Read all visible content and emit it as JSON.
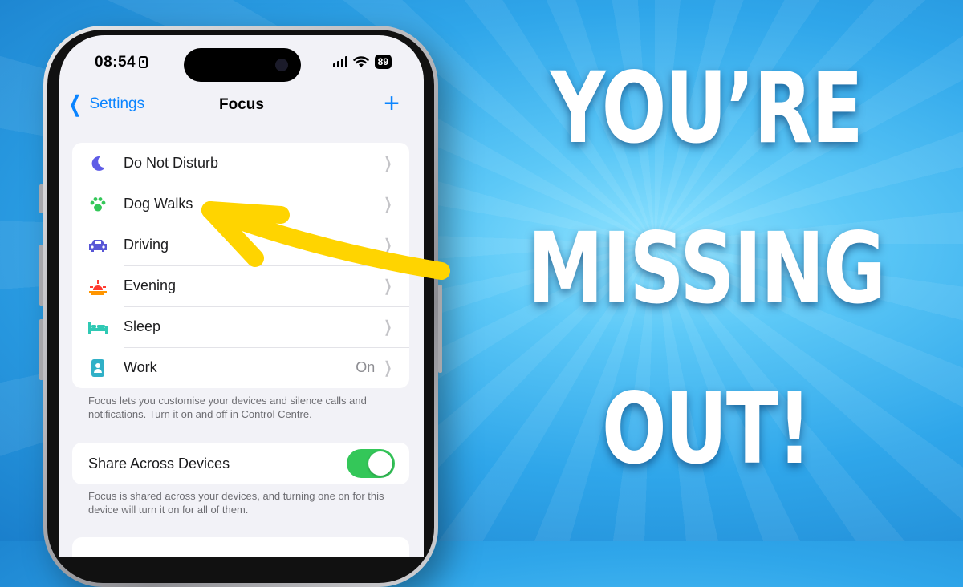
{
  "status_bar": {
    "time": "08:54",
    "battery": "89"
  },
  "nav": {
    "back_label": "Settings",
    "title": "Focus",
    "add_label": "+"
  },
  "focus_modes": [
    {
      "label": "Do Not Disturb",
      "value": "",
      "icon": "moon-icon",
      "color": "#5e5ce6"
    },
    {
      "label": "Dog Walks",
      "value": "",
      "icon": "paw-icon",
      "color": "#34c759"
    },
    {
      "label": "Driving",
      "value": "",
      "icon": "car-icon",
      "color": "#5856d6"
    },
    {
      "label": "Evening",
      "value": "",
      "icon": "sunset-icon",
      "color": "#ff3b30"
    },
    {
      "label": "Sleep",
      "value": "",
      "icon": "bed-icon",
      "color": "#30c9b4"
    },
    {
      "label": "Work",
      "value": "On",
      "icon": "id-badge-icon",
      "color": "#30b0c7"
    }
  ],
  "focus_footnote": "Focus lets you customise your devices and silence calls and notifications. Turn it on and off in Control Centre.",
  "share": {
    "label": "Share Across Devices",
    "enabled": true,
    "footnote": "Focus is shared across your devices, and turning one on for this device will turn it on for all of them."
  },
  "headline": {
    "line1": "YOU’RE",
    "line2": "MISSING",
    "line3": "OUT!"
  },
  "colors": {
    "accent": "#0a84ff",
    "toggle_on": "#34c759",
    "arrow": "#ffd400"
  }
}
